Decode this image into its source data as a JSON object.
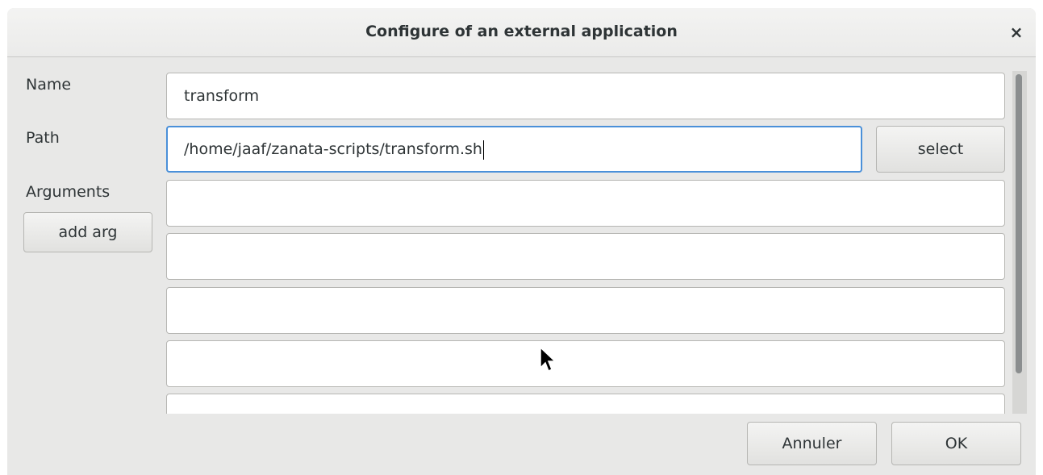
{
  "dialog": {
    "title": "Configure of an external application",
    "close_glyph": "×"
  },
  "form": {
    "name_label": "Name",
    "name_value": "transform",
    "path_label": "Path",
    "path_value": "/home/jaaf/zanata-scripts/transform.sh",
    "select_label": "select",
    "arguments_label": "Arguments",
    "add_arg_label": "add arg",
    "arguments": [
      "",
      "",
      "",
      "",
      ""
    ]
  },
  "footer": {
    "cancel_label": "Annuler",
    "ok_label": "OK"
  },
  "icons": {
    "close": "close-icon",
    "pointer": "mouse-pointer-icon"
  },
  "colors": {
    "focus_border": "#4a90d9",
    "dialog_bg": "#e8e8e7",
    "text": "#2e3436"
  }
}
